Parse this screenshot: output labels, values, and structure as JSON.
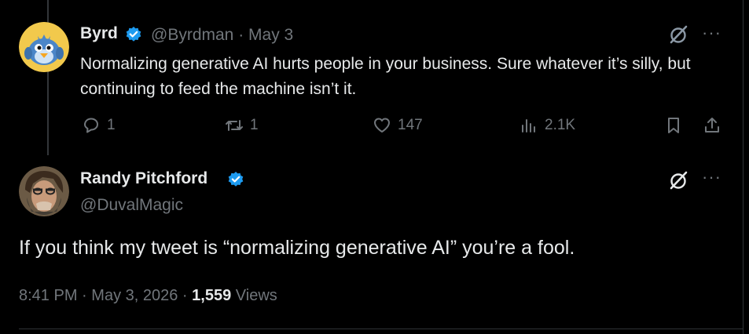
{
  "reply": {
    "author_name": "Byrd",
    "handle": "@Byrdman",
    "separator": "·",
    "date": "May 3",
    "text": "Normalizing generative AI hurts people in your business. Sure whatever it’s silly, but continuing to feed the machine isn’t it.",
    "stats": {
      "replies": "1",
      "retweets": "1",
      "likes": "147",
      "views": "2.1K"
    },
    "more_label": "···"
  },
  "main": {
    "author_name": "Randy Pitchford",
    "handle": "@DuvalMagic",
    "text": "If you think my tweet is “normalizing generative AI” you’re a fool.",
    "time": "8:41 PM",
    "separator": "·",
    "date": "May 3, 2026",
    "views_count": "1,559",
    "views_label": "Views",
    "more_label": "···"
  },
  "colors": {
    "background": "#000000",
    "text": "#e7e9ea",
    "muted": "#71767b",
    "verified": "#1d9bf0",
    "border": "#2f3336"
  },
  "icons": [
    "grok-icon",
    "more-icon",
    "reply-icon",
    "retweet-icon",
    "like-icon",
    "views-icon",
    "bookmark-icon",
    "share-icon",
    "verified-badge-icon"
  ]
}
